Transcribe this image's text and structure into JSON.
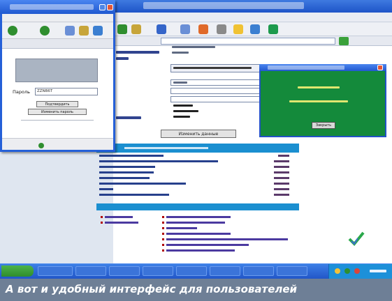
{
  "left_window": {
    "password_label": "Пароль",
    "password_value": "ZZNB6T",
    "buttons": [
      "Подтвердить",
      "Изменить пароль"
    ]
  },
  "main_window": {
    "show_button_label": "Изменить данные"
  },
  "green_dialog": {
    "ok_label": "Закрыть"
  },
  "caption": "А вот и удобный интерфейс для пользователей",
  "colors": {
    "titlebar": "#1d54c8",
    "table_header": "#1b8fd0",
    "dialog_green": "#148a3b",
    "caption_bg": "#6e7f96"
  }
}
